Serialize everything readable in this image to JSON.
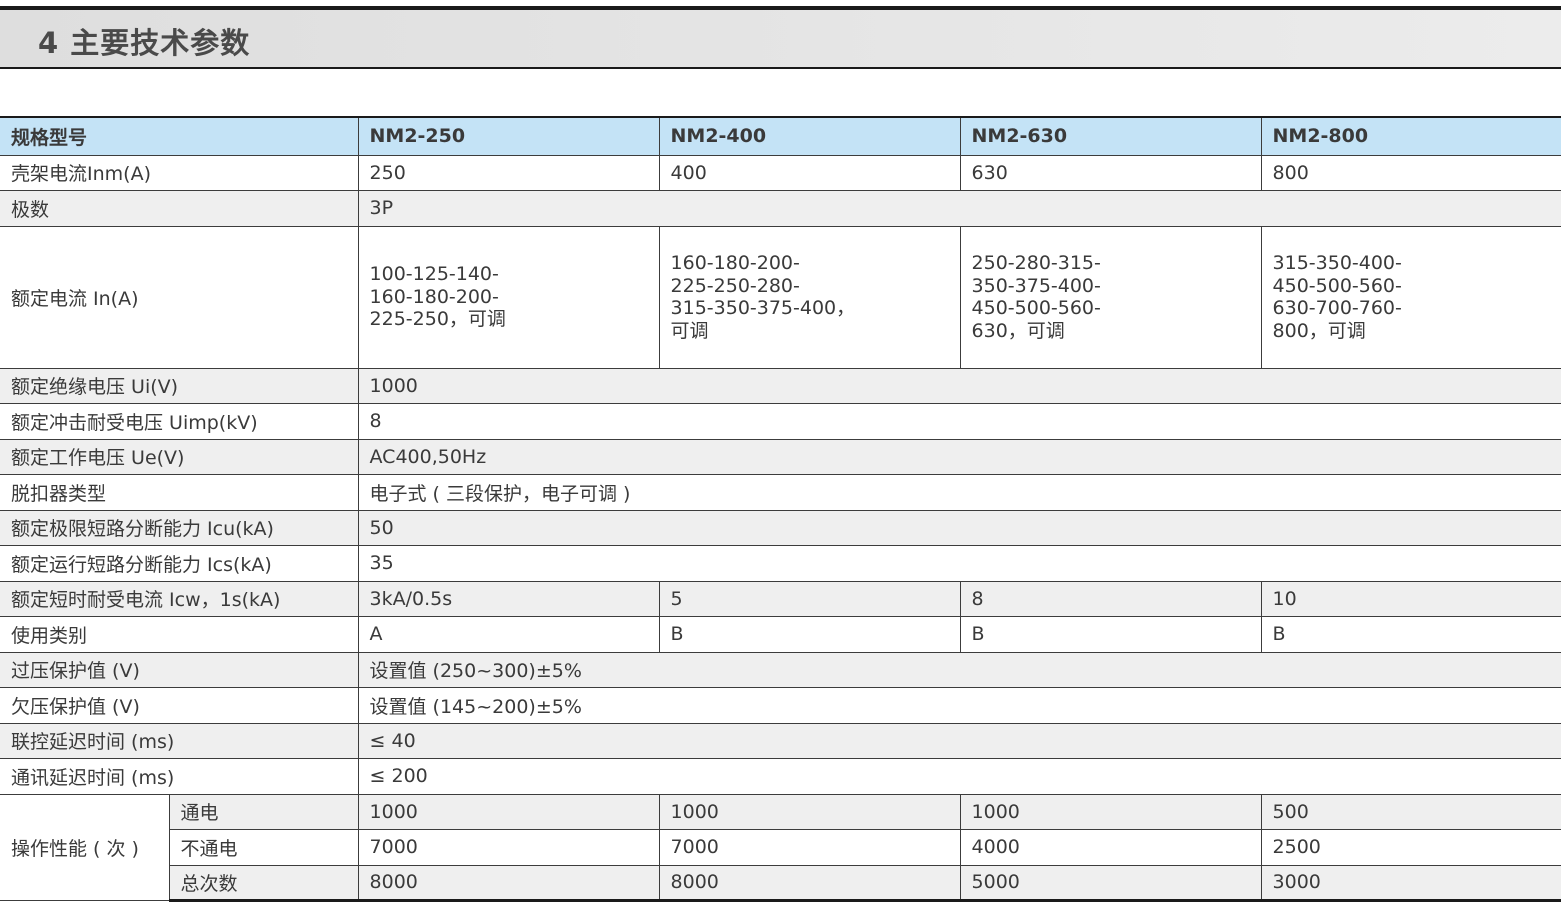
{
  "section": {
    "title": "4 主要技术参数"
  },
  "table": {
    "header": {
      "label": "规格型号",
      "models": [
        "NM2-250",
        "NM2-400",
        "NM2-630",
        "NM2-800"
      ]
    },
    "rows": [
      {
        "label": "壳架电流Inm(A)",
        "values": [
          "250",
          "400",
          "630",
          "800"
        ]
      },
      {
        "label": "极数",
        "value": "3P"
      },
      {
        "label": "额定电流 In(A)",
        "values": [
          "100-125-140-\n160-180-200-\n225-250，可调",
          "160-180-200-\n225-250-280-\n315-350-375-400，\n可调",
          "250-280-315-\n350-375-400-\n450-500-560-\n630，可调",
          "315-350-400-\n450-500-560-\n630-700-760-\n800，可调"
        ]
      },
      {
        "label": "额定绝缘电压 Ui(V)",
        "value": "1000"
      },
      {
        "label": "额定冲击耐受电压 Uimp(kV)",
        "value": "8"
      },
      {
        "label": "额定工作电压 Ue(V)",
        "value": "AC400,50Hz"
      },
      {
        "label": "脱扣器类型",
        "value": "电子式 ( 三段保护，电子可调 )"
      },
      {
        "label": "额定极限短路分断能力 Icu(kA)",
        "value": "50"
      },
      {
        "label": "额定运行短路分断能力 Ics(kA)",
        "value": "35"
      },
      {
        "label": "额定短时耐受电流 Icw，1s(kA)",
        "values": [
          "3kA/0.5s",
          "5",
          "8",
          "10"
        ]
      },
      {
        "label": "使用类别",
        "values": [
          "A",
          "B",
          "B",
          "B"
        ]
      },
      {
        "label": "过压保护值 (V)",
        "value": "设置值 (250~300)±5%"
      },
      {
        "label": "欠压保护值 (V)",
        "value": "设置值 (145~200)±5%"
      },
      {
        "label": "联控延迟时间 (ms)",
        "value": "≤ 40"
      },
      {
        "label": "通讯延迟时间 (ms)",
        "value": "≤ 200"
      }
    ],
    "operation": {
      "label": "操作性能 ( 次 )",
      "subrows": [
        {
          "label": "通电",
          "values": [
            "1000",
            "1000",
            "1000",
            "500"
          ]
        },
        {
          "label": "不通电",
          "values": [
            "7000",
            "7000",
            "4000",
            "2500"
          ]
        },
        {
          "label": "总次数",
          "values": [
            "8000",
            "8000",
            "5000",
            "3000"
          ]
        }
      ]
    }
  }
}
